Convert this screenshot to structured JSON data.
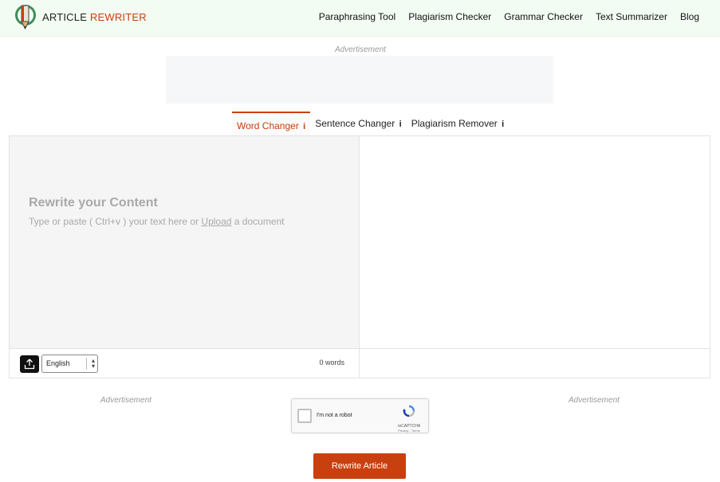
{
  "brand": {
    "word1": "ARTICLE",
    "word2": "REWRITER"
  },
  "nav": {
    "links": [
      "Paraphrasing Tool",
      "Plagiarism Checker",
      "Grammar Checker",
      "Text Summarizer",
      "Blog"
    ]
  },
  "ads": {
    "top": "Advertisement",
    "left": "Advertisement",
    "right": "Advertisement"
  },
  "tabs": [
    {
      "label": "Word Changer",
      "info": "i",
      "active": true
    },
    {
      "label": "Sentence Changer",
      "info": "i",
      "active": false
    },
    {
      "label": "Plagiarism Remover",
      "info": "i",
      "active": false
    }
  ],
  "editor": {
    "placeholder_title": "Rewrite your Content",
    "placeholder_pre": "Type or paste ( Ctrl+v ) your text here or ",
    "placeholder_link": "Upload",
    "placeholder_post": " a document",
    "language": "English",
    "word_count": "0 words"
  },
  "captcha": {
    "label": "I'm not a robot",
    "brand": "reCAPTCHA",
    "links": "Privacy - Terms"
  },
  "actions": {
    "rewrite_label": "Rewrite Article"
  },
  "colors": {
    "accent": "#c8400f",
    "nav_bg": "#f3fcf3"
  }
}
